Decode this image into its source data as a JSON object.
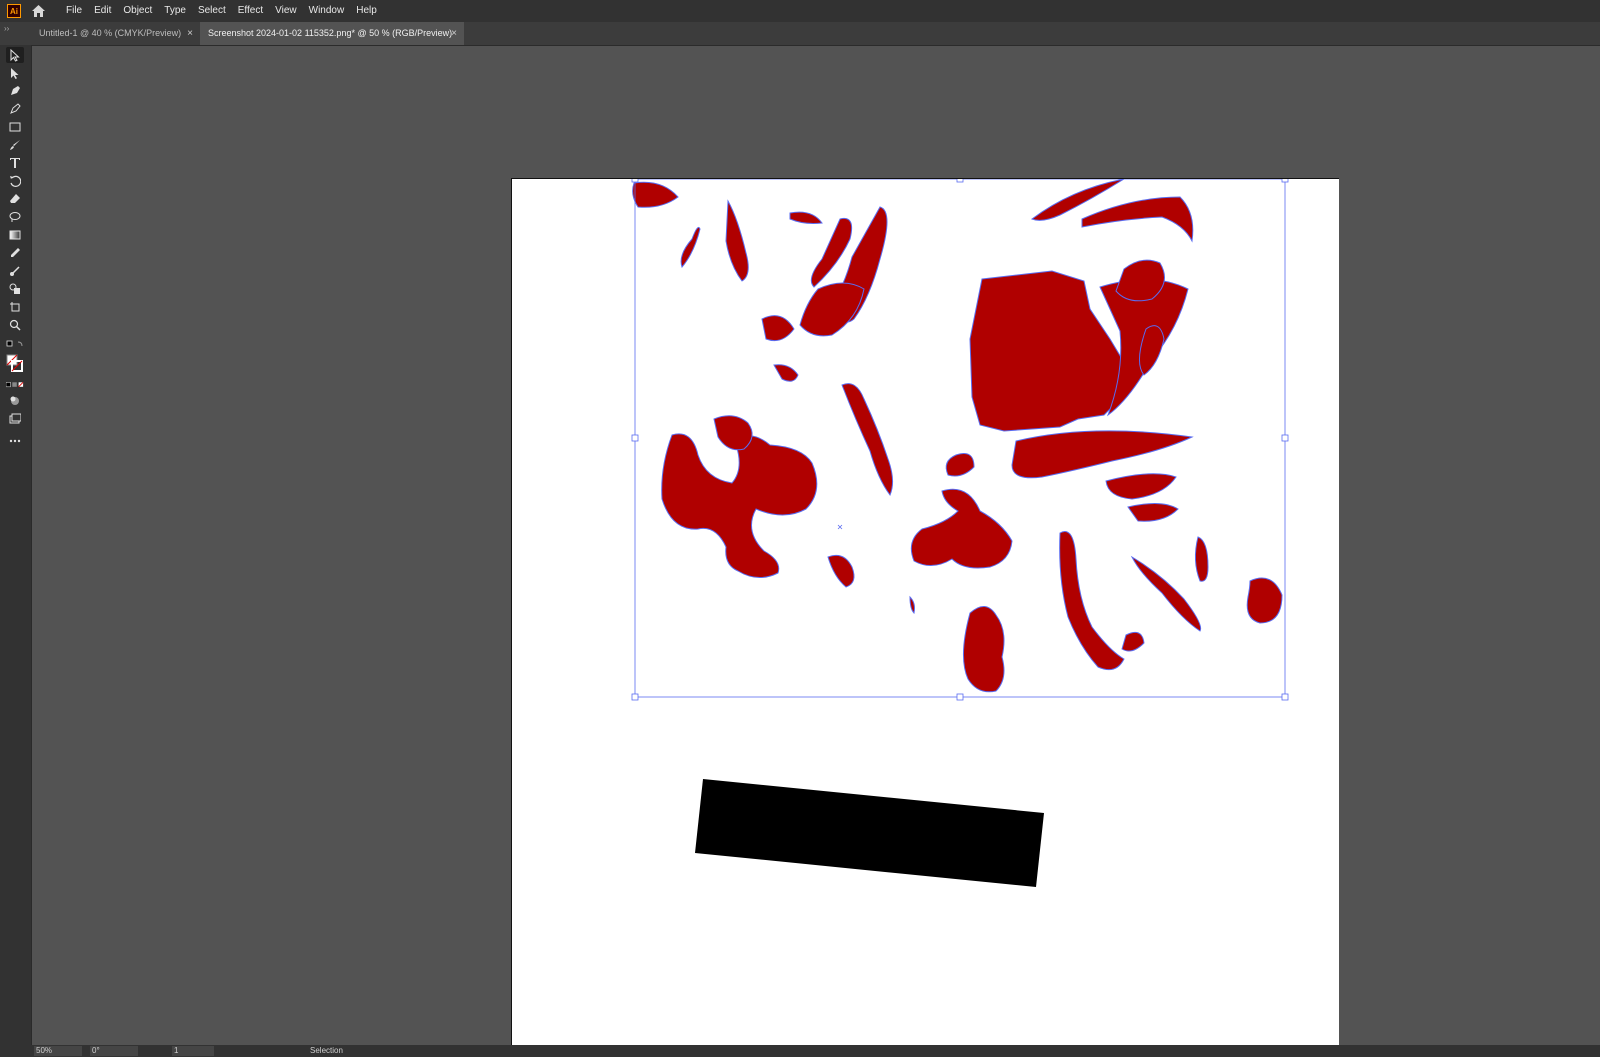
{
  "app": {
    "logo_text": "Ai"
  },
  "menu": [
    "File",
    "Edit",
    "Object",
    "Type",
    "Select",
    "Effect",
    "View",
    "Window",
    "Help"
  ],
  "tabs": [
    {
      "label": "Untitled-1 @ 40 % (CMYK/Preview)",
      "close": "×"
    },
    {
      "label": "Screenshot 2024-01-02 115352.png* @ 50 % (RGB/Preview)",
      "close": "×"
    }
  ],
  "status": {
    "zoom": "50%",
    "rotation": "0°",
    "artboard": "1",
    "tool": "Selection"
  },
  "colors": {
    "fill": "#b00000",
    "selection": "#5a6cf0",
    "rect": "#000000"
  },
  "icons": [
    "selection-tool-icon",
    "direct-selection-tool-icon",
    "pen-tool-icon",
    "curvature-tool-icon",
    "rectangle-tool-icon",
    "paintbrush-tool-icon",
    "type-tool-icon",
    "rotate-tool-icon",
    "eraser-tool-icon",
    "lasso-tool-icon",
    "gradient-tool-icon",
    "eyedropper-tool-icon",
    "puppet-warp-icon",
    "shape-builder-icon",
    "artboard-tool-icon",
    "zoom-tool-icon"
  ]
}
